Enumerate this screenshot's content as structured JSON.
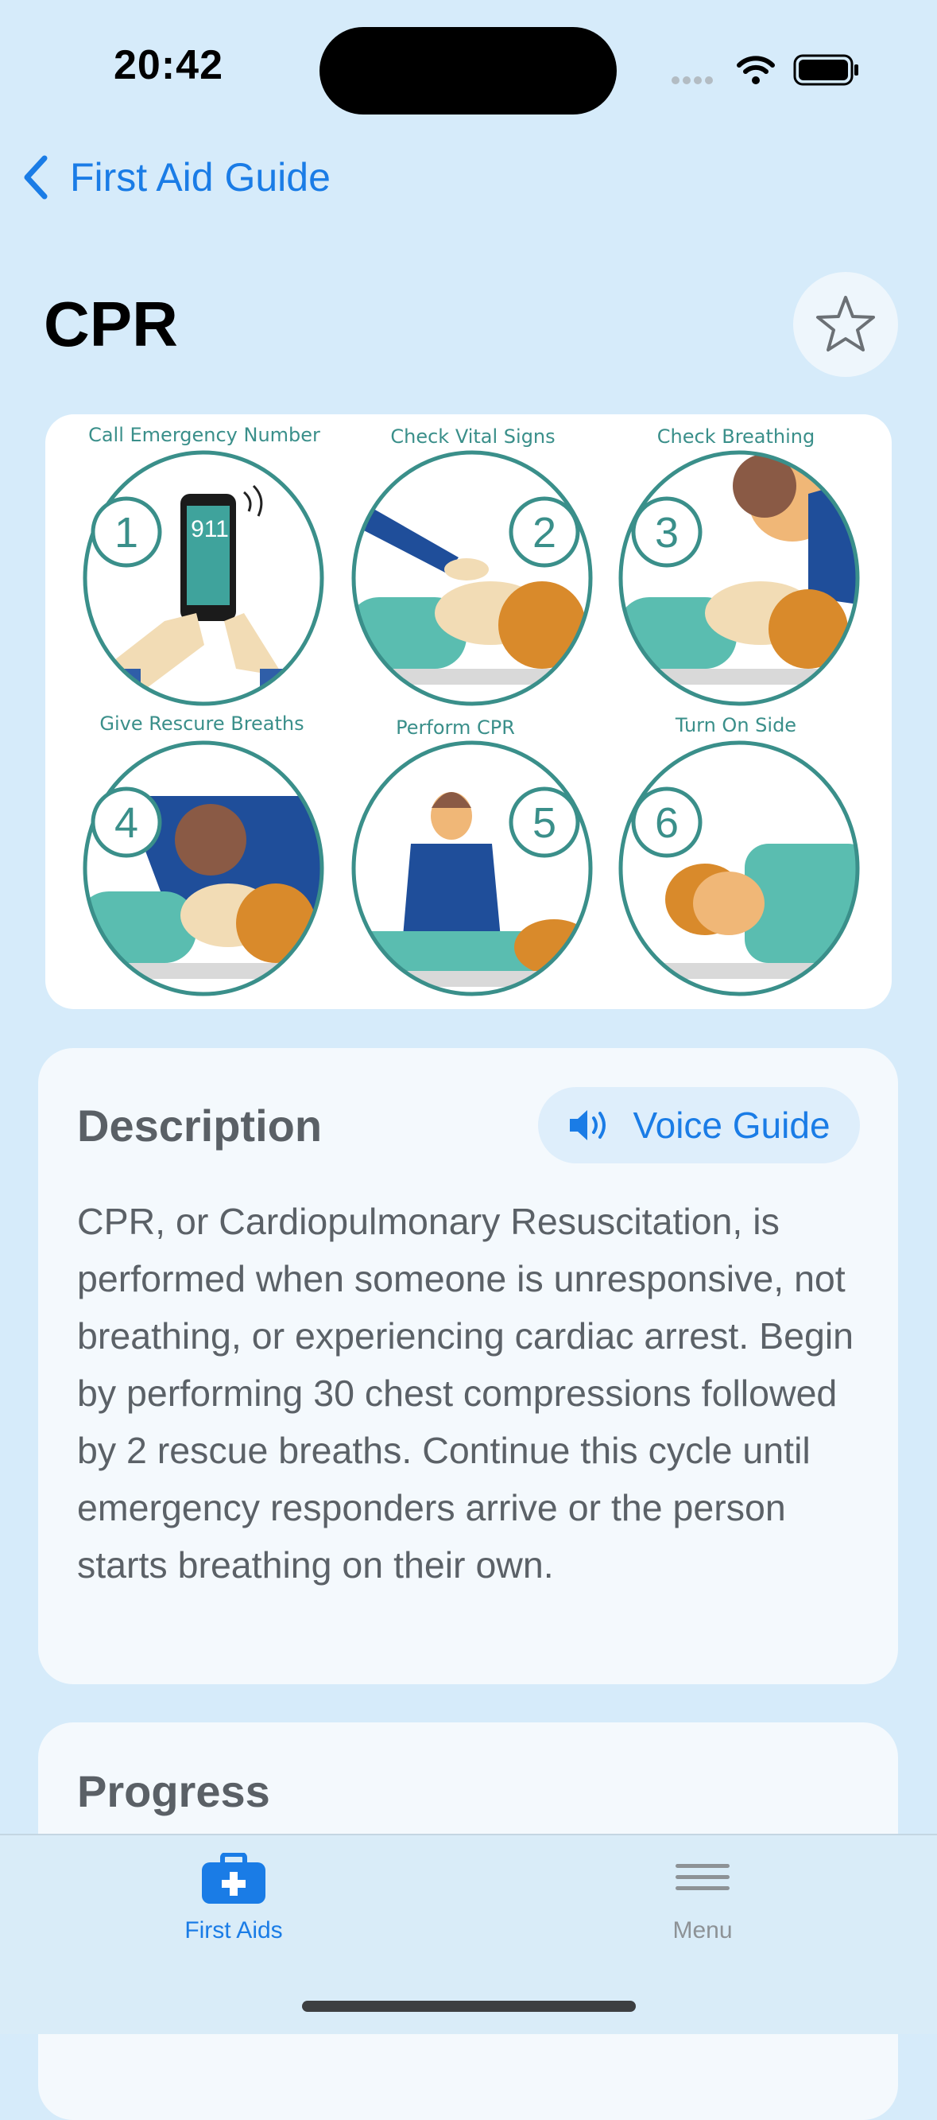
{
  "status_bar": {
    "time": "20:42"
  },
  "nav": {
    "back_label": "First Aid Guide"
  },
  "page": {
    "title": "CPR"
  },
  "steps": [
    {
      "number": "1",
      "label": "Call Emergency Number",
      "phone_text": "911"
    },
    {
      "number": "2",
      "label": "Check Vital Signs"
    },
    {
      "number": "3",
      "label": "Check Breathing"
    },
    {
      "number": "4",
      "label": "Give Rescure Breaths"
    },
    {
      "number": "5",
      "label": "Perform CPR"
    },
    {
      "number": "6",
      "label": "Turn On Side"
    }
  ],
  "description": {
    "heading": "Description",
    "voice_button": "Voice Guide",
    "text": "CPR, or Cardiopulmonary Resuscitation, is performed when someone is unresponsive, not breathing, or experiencing cardiac arrest. Begin by performing 30 chest compressions followed by 2 rescue breaths. Continue this cycle until emergency responders arrive or the person starts breathing on their own."
  },
  "progress": {
    "heading": "Progress"
  },
  "tabbar": {
    "tabs": [
      {
        "label": "First Aids",
        "icon": "first-aid-kit-icon",
        "active": true
      },
      {
        "label": "Menu",
        "icon": "menu-lines-icon",
        "active": false
      }
    ]
  },
  "colors": {
    "background": "#d6ebfa",
    "accent": "#1a7ce6",
    "teal": "#3a8f8a"
  }
}
